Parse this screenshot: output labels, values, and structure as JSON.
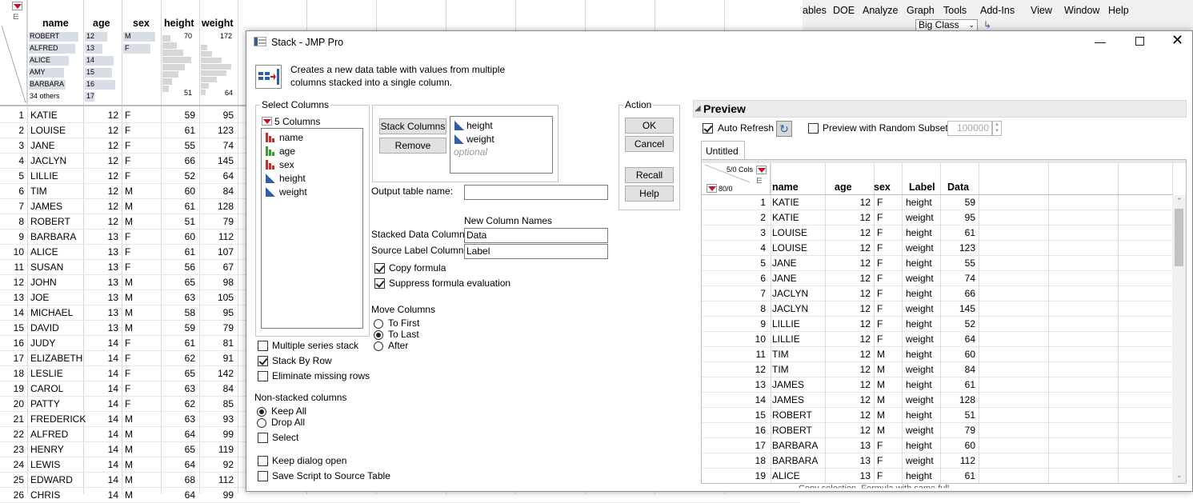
{
  "bg_table": {
    "columns": [
      "name",
      "age",
      "sex",
      "height",
      "weight"
    ],
    "summary": {
      "names": [
        "ROBERT",
        "ALFRED",
        "ALICE",
        "AMY",
        "BARBARA",
        "34 others"
      ],
      "ages": [
        "12",
        "13",
        "14",
        "15",
        "16",
        "17"
      ],
      "sexes": [
        "M",
        "F"
      ],
      "height_range": [
        "70",
        "51"
      ],
      "weight_range": [
        "172",
        "64"
      ]
    },
    "rows": [
      [
        "1",
        "KATIE",
        "12",
        "F",
        "59",
        "95"
      ],
      [
        "2",
        "LOUISE",
        "12",
        "F",
        "61",
        "123"
      ],
      [
        "3",
        "JANE",
        "12",
        "F",
        "55",
        "74"
      ],
      [
        "4",
        "JACLYN",
        "12",
        "F",
        "66",
        "145"
      ],
      [
        "5",
        "LILLIE",
        "12",
        "F",
        "52",
        "64"
      ],
      [
        "6",
        "TIM",
        "12",
        "M",
        "60",
        "84"
      ],
      [
        "7",
        "JAMES",
        "12",
        "M",
        "61",
        "128"
      ],
      [
        "8",
        "ROBERT",
        "12",
        "M",
        "51",
        "79"
      ],
      [
        "9",
        "BARBARA",
        "13",
        "F",
        "60",
        "112"
      ],
      [
        "10",
        "ALICE",
        "13",
        "F",
        "61",
        "107"
      ],
      [
        "11",
        "SUSAN",
        "13",
        "F",
        "56",
        "67"
      ],
      [
        "12",
        "JOHN",
        "13",
        "M",
        "65",
        "98"
      ],
      [
        "13",
        "JOE",
        "13",
        "M",
        "63",
        "105"
      ],
      [
        "14",
        "MICHAEL",
        "13",
        "M",
        "58",
        "95"
      ],
      [
        "15",
        "DAVID",
        "13",
        "M",
        "59",
        "79"
      ],
      [
        "16",
        "JUDY",
        "14",
        "F",
        "61",
        "81"
      ],
      [
        "17",
        "ELIZABETH",
        "14",
        "F",
        "62",
        "91"
      ],
      [
        "18",
        "LESLIE",
        "14",
        "F",
        "65",
        "142"
      ],
      [
        "19",
        "CAROL",
        "14",
        "F",
        "63",
        "84"
      ],
      [
        "20",
        "PATTY",
        "14",
        "F",
        "62",
        "85"
      ],
      [
        "21",
        "FREDERICK",
        "14",
        "M",
        "63",
        "93"
      ],
      [
        "22",
        "ALFRED",
        "14",
        "M",
        "64",
        "99"
      ],
      [
        "23",
        "HENRY",
        "14",
        "M",
        "65",
        "119"
      ],
      [
        "24",
        "LEWIS",
        "14",
        "M",
        "64",
        "92"
      ],
      [
        "25",
        "EDWARD",
        "14",
        "M",
        "68",
        "112"
      ],
      [
        "26",
        "CHRIS",
        "14",
        "M",
        "64",
        "99"
      ]
    ]
  },
  "app_menu": {
    "items": [
      "ables",
      "DOE",
      "Analyze",
      "Graph",
      "Tools",
      "Add-Ins",
      "View",
      "Window",
      "Help"
    ],
    "table_selector": "Big Class"
  },
  "bottom_peek_text": "Copy selection, Formula with same full...",
  "dialog": {
    "title": "Stack - JMP Pro",
    "description_line1": "Creates a new data table with values from multiple",
    "description_line2": "columns stacked into a single column.",
    "select_columns": {
      "label": "Select Columns",
      "count": "5 Columns",
      "items": [
        {
          "name": "name",
          "type": "nominal"
        },
        {
          "name": "age",
          "type": "ordinal"
        },
        {
          "name": "sex",
          "type": "nominal"
        },
        {
          "name": "height",
          "type": "continuous"
        },
        {
          "name": "weight",
          "type": "continuous"
        }
      ]
    },
    "stack_columns_button": "Stack Columns",
    "remove_button": "Remove",
    "stacked_list": [
      "height",
      "weight"
    ],
    "stacked_list_hint": "optional",
    "output_table_label": "Output table name:",
    "output_table_value": "",
    "new_column_names_label": "New Column Names",
    "stacked_data_label": "Stacked Data Column",
    "stacked_data_value": "Data",
    "source_label_label": "Source Label Column",
    "source_label_value": "Label",
    "copy_formula": {
      "label": "Copy formula",
      "checked": true
    },
    "suppress_formula": {
      "label": "Suppress formula evaluation",
      "checked": true
    },
    "move_columns": {
      "label": "Move Columns",
      "options": [
        "To First",
        "To Last",
        "After"
      ],
      "selected": "To Last"
    },
    "multiple_series": {
      "label": "Multiple series stack",
      "checked": false
    },
    "stack_by_row": {
      "label": "Stack By Row",
      "checked": true
    },
    "eliminate_missing": {
      "label": "Eliminate missing rows",
      "checked": false
    },
    "non_stacked": {
      "label": "Non-stacked columns",
      "options": [
        "Keep All",
        "Drop All"
      ],
      "selected": "Keep All",
      "select_label": "Select"
    },
    "keep_dialog_open": {
      "label": "Keep dialog open",
      "checked": false
    },
    "save_script": {
      "label": "Save Script to Source Table",
      "checked": false
    },
    "action": {
      "label": "Action",
      "ok": "OK",
      "cancel": "Cancel",
      "recall": "Recall",
      "help": "Help"
    },
    "preview": {
      "title": "Preview",
      "auto_refresh": {
        "label": "Auto Refresh",
        "checked": true
      },
      "random_subset": {
        "label": "Preview with Random Subset",
        "checked": false,
        "value": "100000"
      },
      "tab": "Untitled",
      "cols_info": "5/0 Cols",
      "rows_info": "80/0",
      "columns": [
        "name",
        "age",
        "sex",
        "Label",
        "Data"
      ],
      "rows": [
        [
          "1",
          "KATIE",
          "12",
          "F",
          "height",
          "59"
        ],
        [
          "2",
          "KATIE",
          "12",
          "F",
          "weight",
          "95"
        ],
        [
          "3",
          "LOUISE",
          "12",
          "F",
          "height",
          "61"
        ],
        [
          "4",
          "LOUISE",
          "12",
          "F",
          "weight",
          "123"
        ],
        [
          "5",
          "JANE",
          "12",
          "F",
          "height",
          "55"
        ],
        [
          "6",
          "JANE",
          "12",
          "F",
          "weight",
          "74"
        ],
        [
          "7",
          "JACLYN",
          "12",
          "F",
          "height",
          "66"
        ],
        [
          "8",
          "JACLYN",
          "12",
          "F",
          "weight",
          "145"
        ],
        [
          "9",
          "LILLIE",
          "12",
          "F",
          "height",
          "52"
        ],
        [
          "10",
          "LILLIE",
          "12",
          "F",
          "weight",
          "64"
        ],
        [
          "11",
          "TIM",
          "12",
          "M",
          "height",
          "60"
        ],
        [
          "12",
          "TIM",
          "12",
          "M",
          "weight",
          "84"
        ],
        [
          "13",
          "JAMES",
          "12",
          "M",
          "height",
          "61"
        ],
        [
          "14",
          "JAMES",
          "12",
          "M",
          "weight",
          "128"
        ],
        [
          "15",
          "ROBERT",
          "12",
          "M",
          "height",
          "51"
        ],
        [
          "16",
          "ROBERT",
          "12",
          "M",
          "weight",
          "79"
        ],
        [
          "17",
          "BARBARA",
          "13",
          "F",
          "height",
          "60"
        ],
        [
          "18",
          "BARBARA",
          "13",
          "F",
          "weight",
          "112"
        ],
        [
          "19",
          "ALICE",
          "13",
          "F",
          "height",
          "61"
        ]
      ]
    }
  }
}
